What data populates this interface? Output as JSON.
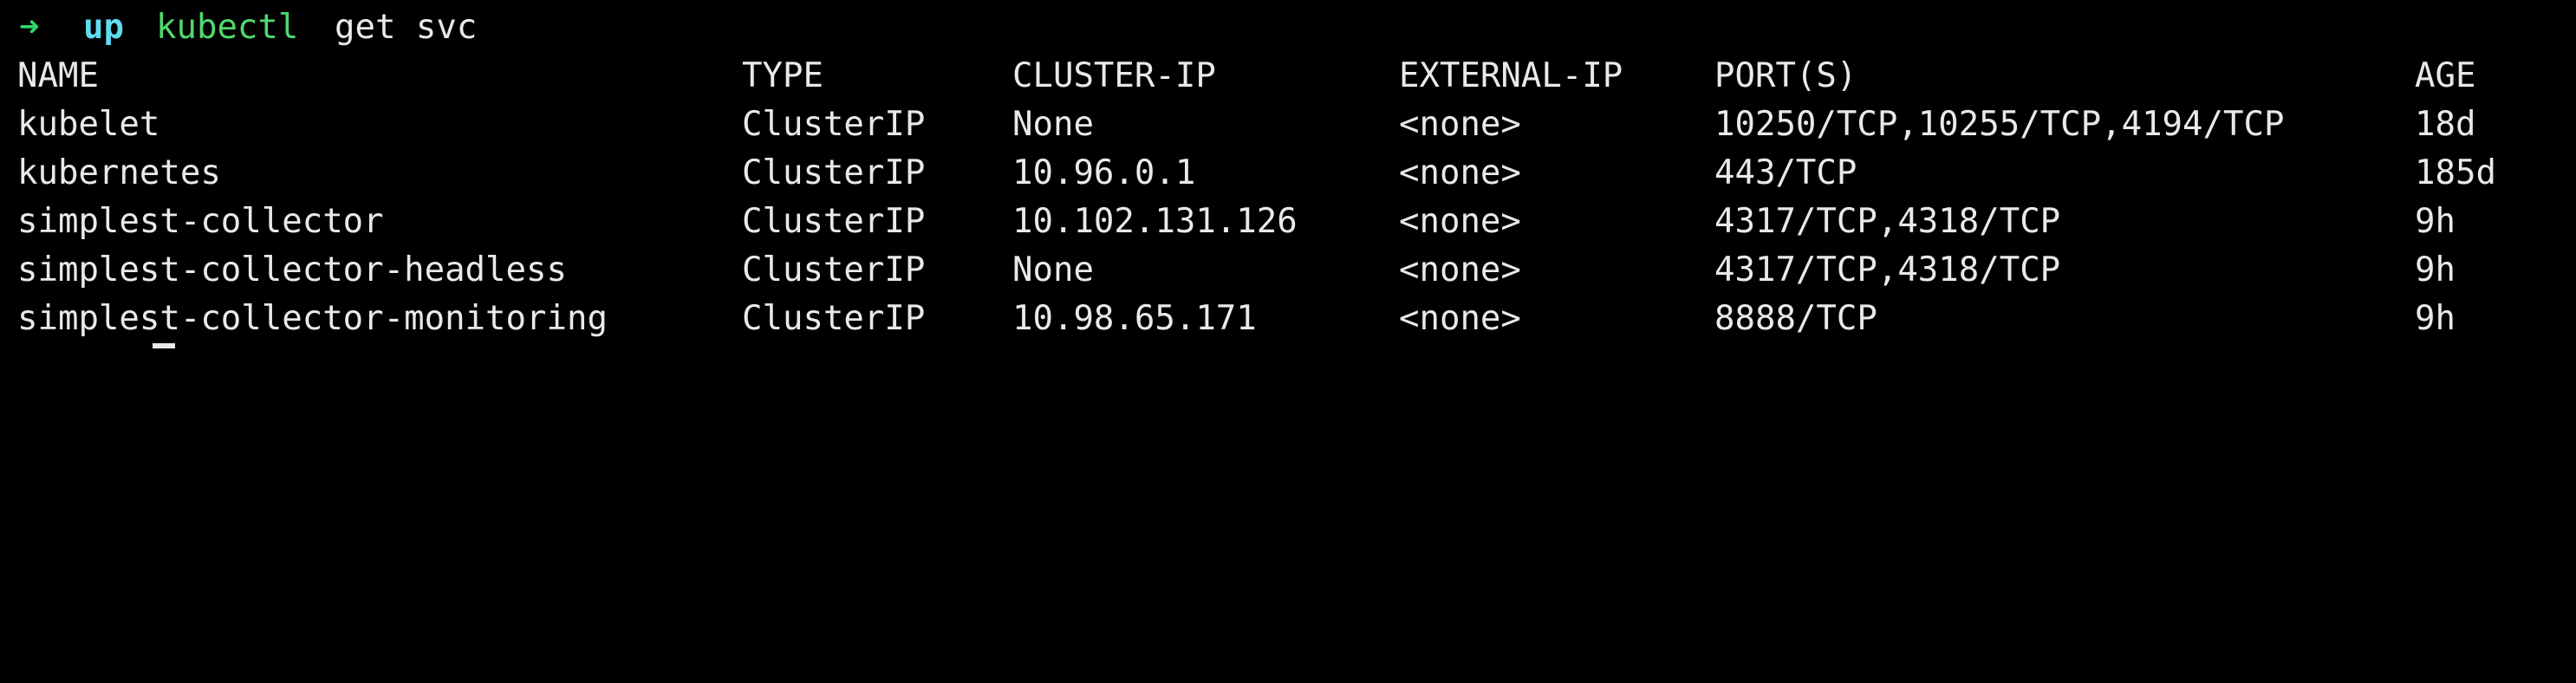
{
  "prompt": {
    "arrow": "➜",
    "directory": "up",
    "command": "kubectl",
    "args": "get svc"
  },
  "table": {
    "headers": [
      "NAME",
      "TYPE",
      "CLUSTER-IP",
      "EXTERNAL-IP",
      "PORT(S)",
      "AGE"
    ],
    "rows": [
      [
        "kubelet",
        "ClusterIP",
        "None",
        "<none>",
        "10250/TCP,10255/TCP,4194/TCP",
        "18d"
      ],
      [
        "kubernetes",
        "ClusterIP",
        "10.96.0.1",
        "<none>",
        "443/TCP",
        "185d"
      ],
      [
        "simplest-collector",
        "ClusterIP",
        "10.102.131.126",
        "<none>",
        "4317/TCP,4318/TCP",
        "9h"
      ],
      [
        "simplest-collector-headless",
        "ClusterIP",
        "None",
        "<none>",
        "4317/TCP,4318/TCP",
        "9h"
      ],
      [
        "simplest-collector-monitoring",
        "ClusterIP",
        "10.98.65.171",
        "<none>",
        "8888/TCP",
        "9h"
      ]
    ]
  },
  "colors": {
    "background": "#000000",
    "text": "#e9e9e9",
    "arrow": "#2fd86a",
    "directory": "#5fdcf0",
    "command": "#4fd96e"
  }
}
